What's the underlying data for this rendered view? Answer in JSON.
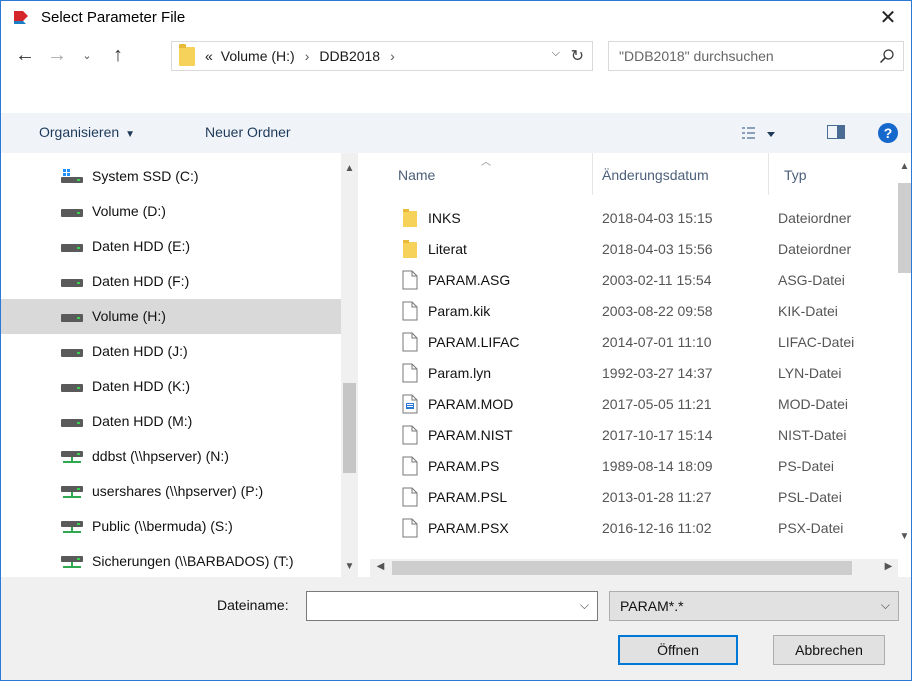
{
  "window": {
    "title": "Select Parameter File"
  },
  "address": {
    "crumbs": [
      "«",
      "Volume (H:)",
      "›",
      "DDB2018",
      "›"
    ]
  },
  "search": {
    "placeholder": "\"DDB2018\" durchsuchen"
  },
  "toolbar": {
    "organize_label": "Organisieren",
    "new_folder_label": "Neuer Ordner"
  },
  "nav": {
    "items": [
      {
        "label": "System SSD (C:)",
        "icon": "windows-drive-icon",
        "selected": false
      },
      {
        "label": "Volume (D:)",
        "icon": "drive-icon",
        "selected": false
      },
      {
        "label": "Daten HDD (E:)",
        "icon": "drive-icon",
        "selected": false
      },
      {
        "label": "Daten HDD (F:)",
        "icon": "drive-icon",
        "selected": false
      },
      {
        "label": "Volume (H:)",
        "icon": "drive-icon",
        "selected": true
      },
      {
        "label": "Daten HDD (J:)",
        "icon": "drive-icon",
        "selected": false
      },
      {
        "label": "Daten HDD (K:)",
        "icon": "drive-icon",
        "selected": false
      },
      {
        "label": "Daten HDD (M:)",
        "icon": "drive-icon",
        "selected": false
      },
      {
        "label": "ddbst (\\\\hpserver) (N:)",
        "icon": "network-drive-icon",
        "selected": false
      },
      {
        "label": "usershares (\\\\hpserver) (P:)",
        "icon": "network-drive-icon",
        "selected": false
      },
      {
        "label": "Public (\\\\bermuda) (S:)",
        "icon": "network-drive-icon",
        "selected": false
      },
      {
        "label": "Sicherungen (\\\\BARBADOS) (T:)",
        "icon": "network-drive-icon",
        "selected": false
      }
    ]
  },
  "columns": {
    "name": "Name",
    "date": "Änderungsdatum",
    "type": "Typ"
  },
  "files": [
    {
      "name": "INKS",
      "date": "2018-04-03 15:15",
      "type": "Dateiordner",
      "icon": "folder-icon"
    },
    {
      "name": "Literat",
      "date": "2018-04-03 15:56",
      "type": "Dateiordner",
      "icon": "folder-icon"
    },
    {
      "name": "PARAM.ASG",
      "date": "2003-02-11 15:54",
      "type": "ASG-Datei",
      "icon": "file-icon"
    },
    {
      "name": "Param.kik",
      "date": "2003-08-22 09:58",
      "type": "KIK-Datei",
      "icon": "file-icon"
    },
    {
      "name": "PARAM.LIFAC",
      "date": "2014-07-01 11:10",
      "type": "LIFAC-Datei",
      "icon": "file-icon"
    },
    {
      "name": "Param.lyn",
      "date": "1992-03-27 14:37",
      "type": "LYN-Datei",
      "icon": "file-icon"
    },
    {
      "name": "PARAM.MOD",
      "date": "2017-05-05 11:21",
      "type": "MOD-Datei",
      "icon": "document-icon"
    },
    {
      "name": "PARAM.NIST",
      "date": "2017-10-17 15:14",
      "type": "NIST-Datei",
      "icon": "file-icon"
    },
    {
      "name": "PARAM.PS",
      "date": "1989-08-14 18:09",
      "type": "PS-Datei",
      "icon": "file-icon"
    },
    {
      "name": "PARAM.PSL",
      "date": "2013-01-28 11:27",
      "type": "PSL-Datei",
      "icon": "file-icon"
    },
    {
      "name": "PARAM.PSX",
      "date": "2016-12-16 11:02",
      "type": "PSX-Datei",
      "icon": "file-icon"
    }
  ],
  "bottom": {
    "filename_label": "Dateiname:",
    "filename_value": "",
    "filter_value": "PARAM*.*",
    "open_label": "Öffnen",
    "cancel_label": "Abbrechen"
  },
  "colors": {
    "accent": "#0078d7",
    "help": "#1668cc",
    "folder": "#f7d25b",
    "selected_row": "#d9d9d9",
    "toolbar_bg": "#f0f4f9"
  }
}
